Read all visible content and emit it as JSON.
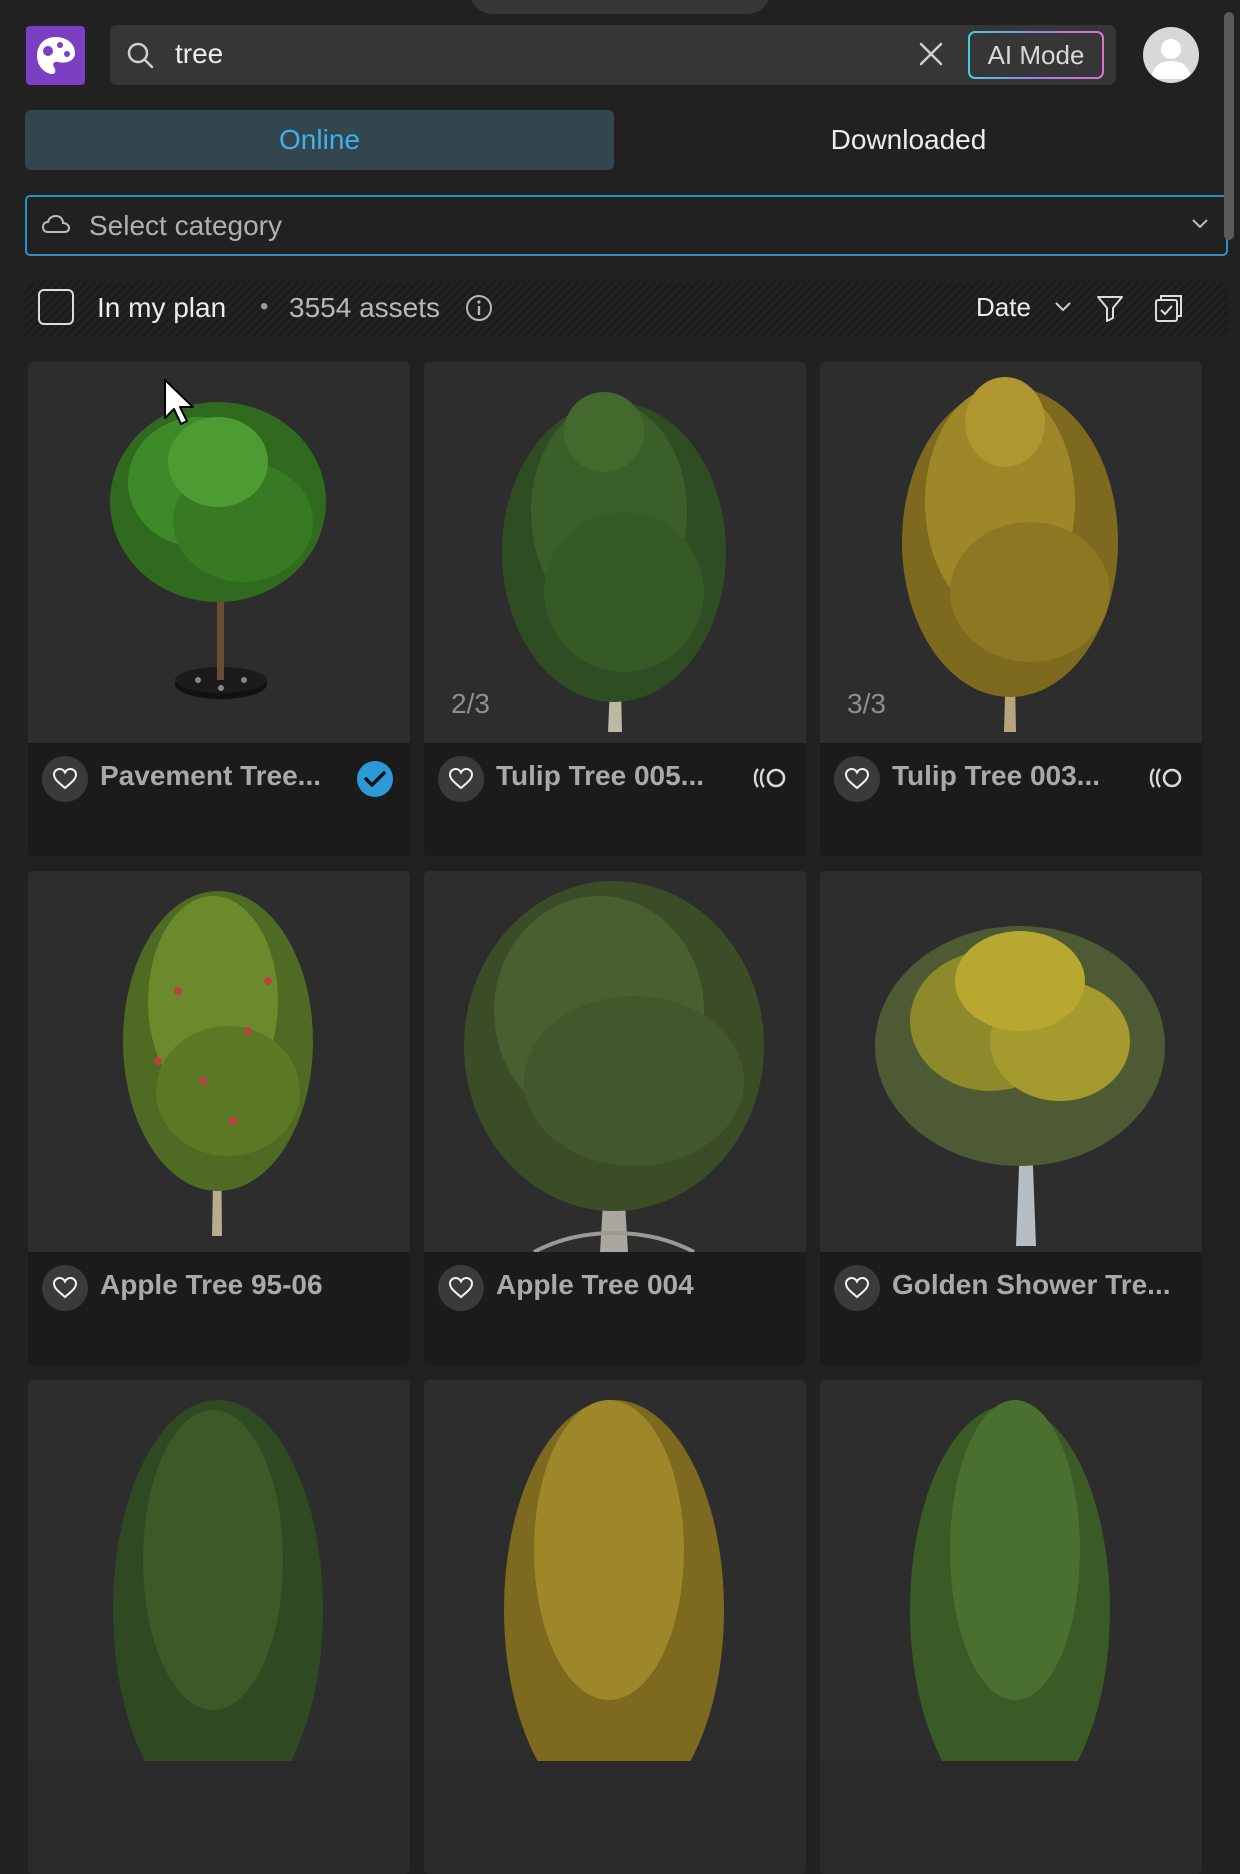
{
  "search": {
    "query": "tree",
    "ai_mode_label": "AI Mode"
  },
  "tabs": [
    {
      "label": "Online",
      "active": true
    },
    {
      "label": "Downloaded",
      "active": false
    }
  ],
  "category": {
    "placeholder": "Select category"
  },
  "filterbar": {
    "plan_label": "In my plan",
    "separator": "•",
    "assets_count": "3554 assets",
    "sort_label": "Date"
  },
  "assets": [
    {
      "name": "Pavement Tree...",
      "counter": "",
      "status": "downloaded"
    },
    {
      "name": "Tulip Tree 005...",
      "counter": "2/3",
      "status": "variants"
    },
    {
      "name": "Tulip Tree 003...",
      "counter": "3/3",
      "status": "variants"
    },
    {
      "name": "Apple Tree 95-06",
      "counter": "",
      "status": ""
    },
    {
      "name": "Apple Tree 004",
      "counter": "",
      "status": ""
    },
    {
      "name": "Golden Shower Tre...",
      "counter": "",
      "status": ""
    }
  ],
  "colors": {
    "accent": "#3cb2e8",
    "logo": "#7b3fc4",
    "check": "#2a9ad9",
    "background": "#212121"
  }
}
